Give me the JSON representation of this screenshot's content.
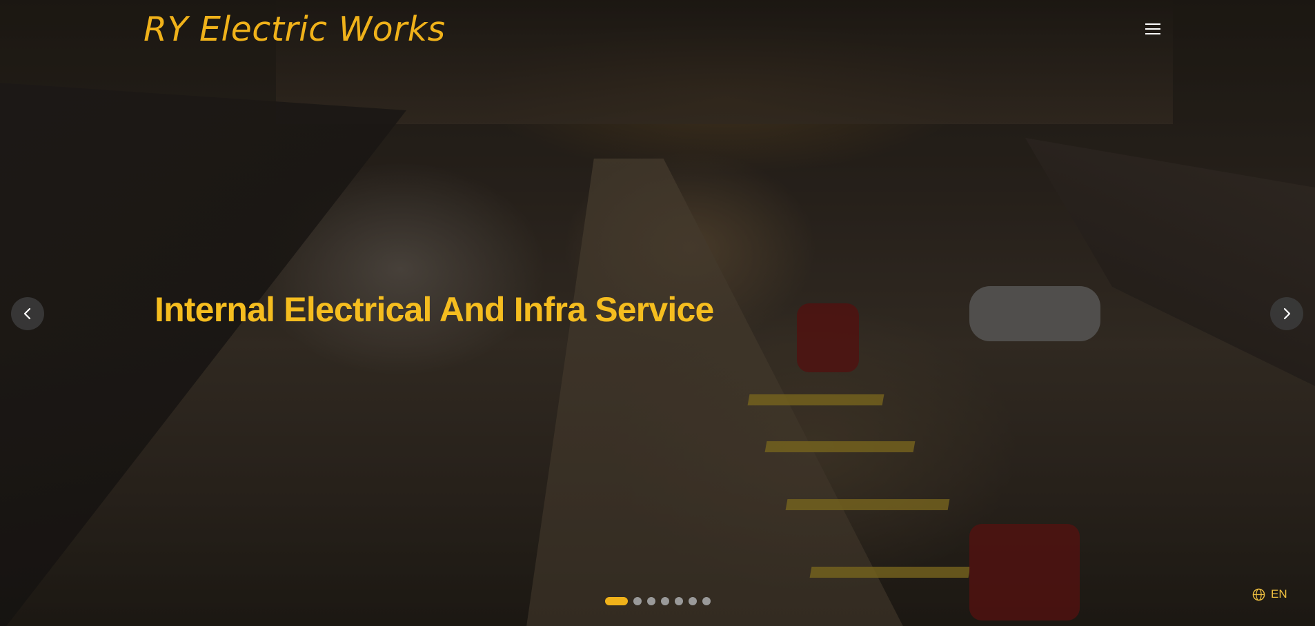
{
  "header": {
    "brand": "RY Electric Works",
    "menu_icon": "hamburger-menu-icon"
  },
  "hero": {
    "headline": "Internal Electrical And Infra Service",
    "prev_icon": "chevron-left-icon",
    "next_icon": "chevron-right-icon",
    "slide_count": 7,
    "active_slide": 1
  },
  "language": {
    "icon": "globe-icon",
    "label": "EN"
  },
  "colors": {
    "accent": "#f0b21a",
    "headline": "#f5bd1f",
    "dot_inactive": "#9a9a9a",
    "arrow_bg": "#3c3c3c"
  }
}
